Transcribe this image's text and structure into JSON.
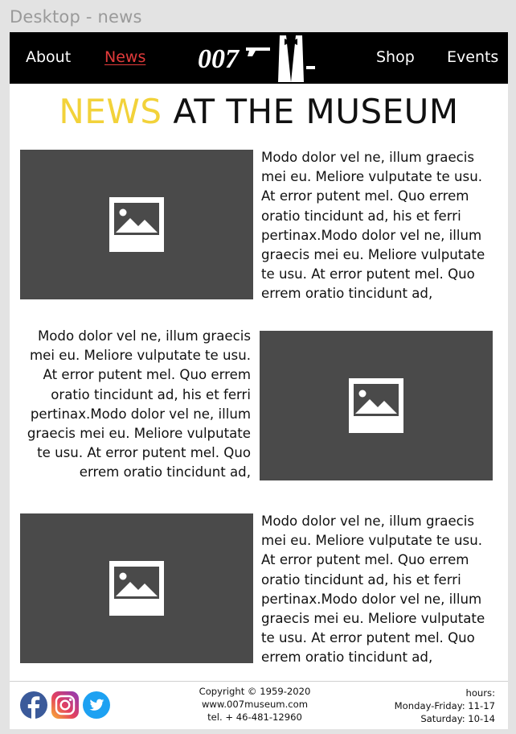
{
  "frame_label": "Desktop - news",
  "nav": {
    "about": "About",
    "news": "News",
    "shop": "Shop",
    "events": "Events",
    "logo_text": "007"
  },
  "title": {
    "accent": "NEWS",
    "rest": " AT THE MUSEUM"
  },
  "articles": [
    {
      "text": "Modo dolor vel ne, illum graecis mei eu. Meliore vulputate te usu. At error putent mel. Quo errem oratio tincidunt ad, his et ferri pertinax.Modo dolor vel ne, illum graecis mei eu. Meliore vulputate te usu. At error putent mel. Quo errem oratio tincidunt ad,"
    },
    {
      "text": "Modo dolor vel ne, illum graecis mei eu. Meliore vulputate te usu. At error putent mel. Quo errem oratio tincidunt ad, his et ferri pertinax.Modo dolor vel ne, illum graecis mei eu. Meliore vulputate te usu. At error putent mel. Quo errem oratio tincidunt ad,"
    },
    {
      "text": "Modo dolor vel ne, illum graecis mei eu. Meliore vulputate te usu. At error putent mel. Quo errem oratio tincidunt ad, his et ferri pertinax.Modo dolor vel ne, illum graecis mei eu. Meliore vulputate te usu. At error putent mel. Quo errem oratio tincidunt ad,"
    }
  ],
  "footer": {
    "copyright": "Copyright © 1959-2020",
    "website": "www.007museum.com",
    "phone": "tel. + 46-481-12960",
    "hours_label": "hours:",
    "weekday_hours": "Monday-Friday: 11-17",
    "saturday_hours": "Saturday: 10-14"
  },
  "icons": [
    "image-placeholder-icon",
    "facebook-icon",
    "instagram-icon",
    "twitter-icon",
    "tuxedo-icon"
  ],
  "colors": {
    "nav_bg": "#000000",
    "active_link": "#e23b3b",
    "title_accent": "#f2d23a",
    "placeholder": "#4a4a4a"
  }
}
